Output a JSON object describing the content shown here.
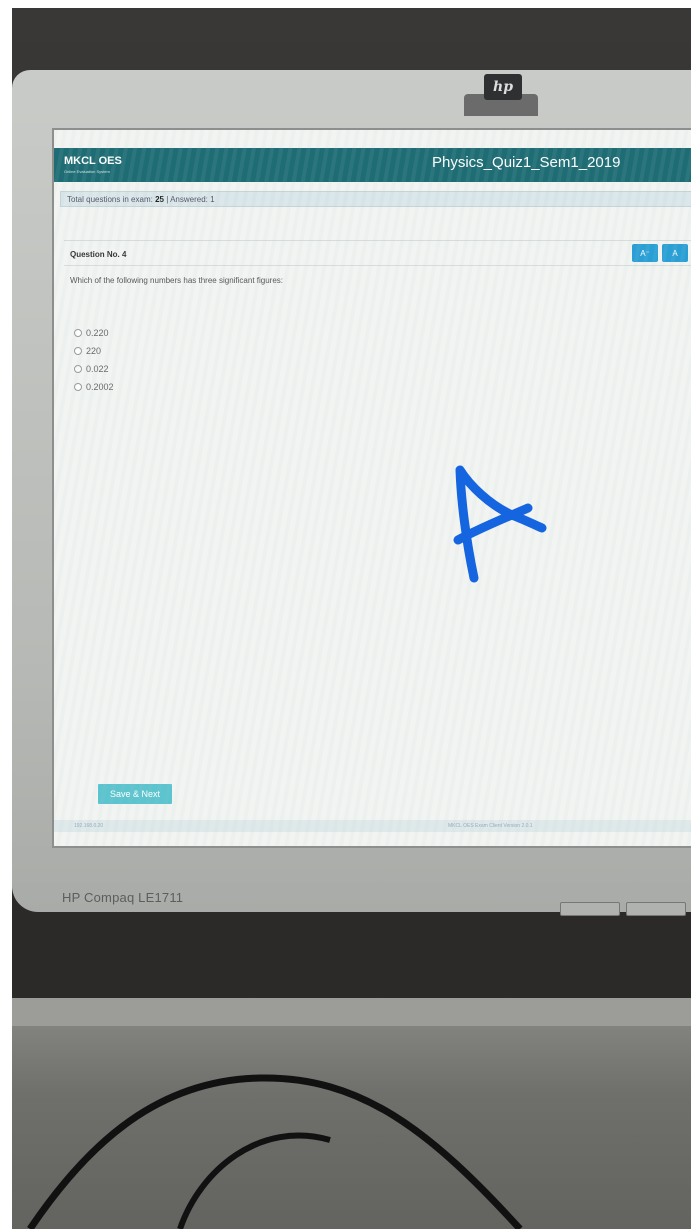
{
  "monitor": {
    "brand_logo": "hp",
    "model_label": "HP Compaq LE1711"
  },
  "app": {
    "logo": "MKCL OES",
    "logo_subtitle": "Online Evaluation System",
    "exam_title": "Physics_Quiz1_Sem1_2019"
  },
  "stats": {
    "total_label": "Total questions in exam:",
    "total_value": "25",
    "separator": "|",
    "answered_label": "Answered:",
    "answered_value": "1"
  },
  "question": {
    "number_label": "Question No. 4",
    "text": "Which of the following numbers has three significant figures:",
    "options": [
      "0.220",
      "220",
      "0.022",
      "0.2002"
    ],
    "font_decrease": "A⁻",
    "font_default": "A"
  },
  "actions": {
    "save_next": "Save & Next"
  },
  "footer": {
    "left": "192.168.0.20",
    "right": "MKCL OES Exam Client Version 2.0.1"
  },
  "annotation": {
    "handwritten_letter": "A",
    "color": "#1565e0"
  }
}
